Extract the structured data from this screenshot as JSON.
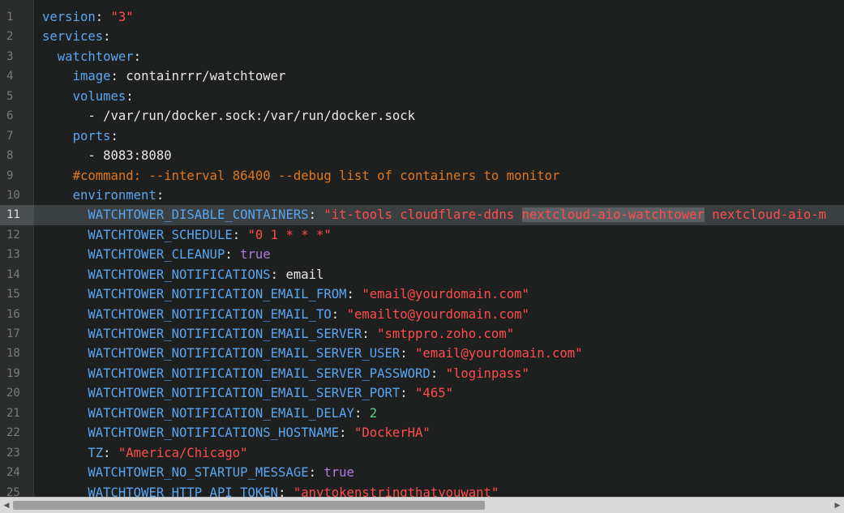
{
  "editor": {
    "active_line": 11,
    "lines": [
      {
        "n": "1",
        "tokens": [
          {
            "t": "key",
            "v": "version"
          },
          {
            "t": "punct",
            "v": ": "
          },
          {
            "t": "string",
            "v": "\"3\""
          }
        ]
      },
      {
        "n": "2",
        "tokens": [
          {
            "t": "key",
            "v": "services"
          },
          {
            "t": "punct",
            "v": ":"
          }
        ]
      },
      {
        "n": "3",
        "tokens": [
          {
            "t": "plain",
            "v": "  "
          },
          {
            "t": "key",
            "v": "watchtower"
          },
          {
            "t": "punct",
            "v": ":"
          }
        ]
      },
      {
        "n": "4",
        "tokens": [
          {
            "t": "plain",
            "v": "    "
          },
          {
            "t": "key",
            "v": "image"
          },
          {
            "t": "punct",
            "v": ": "
          },
          {
            "t": "plain",
            "v": "containrrr/watchtower"
          }
        ]
      },
      {
        "n": "5",
        "tokens": [
          {
            "t": "plain",
            "v": "    "
          },
          {
            "t": "key",
            "v": "volumes"
          },
          {
            "t": "punct",
            "v": ":"
          }
        ]
      },
      {
        "n": "6",
        "tokens": [
          {
            "t": "plain",
            "v": "      - /var/run/docker.sock:/var/run/docker.sock"
          }
        ]
      },
      {
        "n": "7",
        "tokens": [
          {
            "t": "plain",
            "v": "    "
          },
          {
            "t": "key",
            "v": "ports"
          },
          {
            "t": "punct",
            "v": ":"
          }
        ]
      },
      {
        "n": "8",
        "tokens": [
          {
            "t": "plain",
            "v": "      - 8083:8080"
          }
        ]
      },
      {
        "n": "9",
        "tokens": [
          {
            "t": "plain",
            "v": "    "
          },
          {
            "t": "comment",
            "v": "#command: --interval 86400 --debug list of containers to monitor"
          }
        ]
      },
      {
        "n": "10",
        "tokens": [
          {
            "t": "plain",
            "v": "    "
          },
          {
            "t": "key",
            "v": "environment"
          },
          {
            "t": "punct",
            "v": ":"
          }
        ]
      },
      {
        "n": "11",
        "tokens": [
          {
            "t": "plain",
            "v": "      "
          },
          {
            "t": "key",
            "v": "WATCHTOWER_DISABLE_CONTAINERS"
          },
          {
            "t": "punct",
            "v": ": "
          },
          {
            "t": "string",
            "v": "\"it-tools cloudflare-ddns "
          },
          {
            "t": "string-sel",
            "v": "nextcloud-aio-watchtower"
          },
          {
            "t": "string",
            "v": " nextcloud-aio-m"
          }
        ]
      },
      {
        "n": "12",
        "tokens": [
          {
            "t": "plain",
            "v": "      "
          },
          {
            "t": "key",
            "v": "WATCHTOWER_SCHEDULE"
          },
          {
            "t": "punct",
            "v": ": "
          },
          {
            "t": "string",
            "v": "\"0 1 * * *\""
          }
        ]
      },
      {
        "n": "13",
        "tokens": [
          {
            "t": "plain",
            "v": "      "
          },
          {
            "t": "key",
            "v": "WATCHTOWER_CLEANUP"
          },
          {
            "t": "punct",
            "v": ": "
          },
          {
            "t": "bool",
            "v": "true"
          }
        ]
      },
      {
        "n": "14",
        "tokens": [
          {
            "t": "plain",
            "v": "      "
          },
          {
            "t": "key",
            "v": "WATCHTOWER_NOTIFICATIONS"
          },
          {
            "t": "punct",
            "v": ": "
          },
          {
            "t": "plain",
            "v": "email"
          }
        ]
      },
      {
        "n": "15",
        "tokens": [
          {
            "t": "plain",
            "v": "      "
          },
          {
            "t": "key",
            "v": "WATCHTOWER_NOTIFICATION_EMAIL_FROM"
          },
          {
            "t": "punct",
            "v": ": "
          },
          {
            "t": "string",
            "v": "\"email@yourdomain.com\""
          }
        ]
      },
      {
        "n": "16",
        "tokens": [
          {
            "t": "plain",
            "v": "      "
          },
          {
            "t": "key",
            "v": "WATCHTOWER_NOTIFICATION_EMAIL_TO"
          },
          {
            "t": "punct",
            "v": ": "
          },
          {
            "t": "string",
            "v": "\"emailto@yourdomain.com\""
          }
        ]
      },
      {
        "n": "17",
        "tokens": [
          {
            "t": "plain",
            "v": "      "
          },
          {
            "t": "key",
            "v": "WATCHTOWER_NOTIFICATION_EMAIL_SERVER"
          },
          {
            "t": "punct",
            "v": ": "
          },
          {
            "t": "string",
            "v": "\"smtppro.zoho.com\""
          }
        ]
      },
      {
        "n": "18",
        "tokens": [
          {
            "t": "plain",
            "v": "      "
          },
          {
            "t": "key",
            "v": "WATCHTOWER_NOTIFICATION_EMAIL_SERVER_USER"
          },
          {
            "t": "punct",
            "v": ": "
          },
          {
            "t": "string",
            "v": "\"email@yourdomain.com\""
          }
        ]
      },
      {
        "n": "19",
        "tokens": [
          {
            "t": "plain",
            "v": "      "
          },
          {
            "t": "key",
            "v": "WATCHTOWER_NOTIFICATION_EMAIL_SERVER_PASSWORD"
          },
          {
            "t": "punct",
            "v": ": "
          },
          {
            "t": "string",
            "v": "\"loginpass\""
          }
        ]
      },
      {
        "n": "20",
        "tokens": [
          {
            "t": "plain",
            "v": "      "
          },
          {
            "t": "key",
            "v": "WATCHTOWER_NOTIFICATION_EMAIL_SERVER_PORT"
          },
          {
            "t": "punct",
            "v": ": "
          },
          {
            "t": "string",
            "v": "\"465\""
          }
        ]
      },
      {
        "n": "21",
        "tokens": [
          {
            "t": "plain",
            "v": "      "
          },
          {
            "t": "key",
            "v": "WATCHTOWER_NOTIFICATION_EMAIL_DELAY"
          },
          {
            "t": "punct",
            "v": ": "
          },
          {
            "t": "num",
            "v": "2"
          }
        ]
      },
      {
        "n": "22",
        "tokens": [
          {
            "t": "plain",
            "v": "      "
          },
          {
            "t": "key",
            "v": "WATCHTOWER_NOTIFICATIONS_HOSTNAME"
          },
          {
            "t": "punct",
            "v": ": "
          },
          {
            "t": "string",
            "v": "\"DockerHA\""
          }
        ]
      },
      {
        "n": "23",
        "tokens": [
          {
            "t": "plain",
            "v": "      "
          },
          {
            "t": "key",
            "v": "TZ"
          },
          {
            "t": "punct",
            "v": ": "
          },
          {
            "t": "string",
            "v": "\"America/Chicago\""
          }
        ]
      },
      {
        "n": "24",
        "tokens": [
          {
            "t": "plain",
            "v": "      "
          },
          {
            "t": "key",
            "v": "WATCHTOWER_NO_STARTUP_MESSAGE"
          },
          {
            "t": "punct",
            "v": ": "
          },
          {
            "t": "bool",
            "v": "true"
          }
        ]
      },
      {
        "n": "25",
        "tokens": [
          {
            "t": "plain",
            "v": "      "
          },
          {
            "t": "key",
            "v": "WATCHTOWER_HTTP_API_TOKEN"
          },
          {
            "t": "punct",
            "v": ": "
          },
          {
            "t": "string",
            "v": "\"anytokenstringthatyouwant\""
          }
        ]
      }
    ]
  },
  "scrollbar": {
    "left_arrow": "◀",
    "right_arrow": "▶"
  },
  "colors": {
    "background": "#1e1f1f",
    "key": "#5aa6f0",
    "string": "#ff4d4d",
    "bool": "#b07ae0",
    "number": "#55d68a",
    "comment": "#e0781e",
    "plain": "#e8e8e8"
  }
}
